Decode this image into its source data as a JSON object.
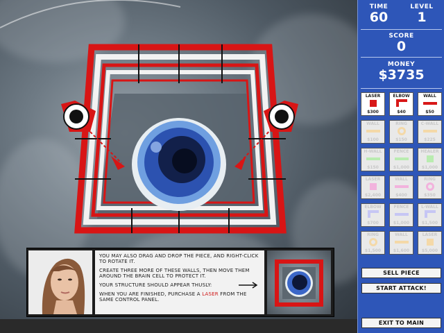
{
  "hud": {
    "time_label": "TIME",
    "time_value": "60",
    "level_label": "LEVEL",
    "level_value": "1",
    "score_label": "SCORE",
    "score_value": "0",
    "money_label": "MONEY",
    "money_value": "$3735"
  },
  "shop": {
    "items": [
      {
        "name": "LASER",
        "price": "$300",
        "icon": "laser-icon",
        "active": true
      },
      {
        "name": "ELBOW",
        "price": "$40",
        "icon": "elbow-icon",
        "active": true
      },
      {
        "name": "WALL",
        "price": "$50",
        "icon": "wall-icon",
        "active": true
      },
      {
        "name": "WALL",
        "price": "$100",
        "icon": "wall-icon",
        "active": false
      },
      {
        "name": "RING",
        "price": "$150",
        "icon": "ring-icon",
        "active": false
      },
      {
        "name": "C-WALL",
        "price": "$225",
        "icon": "c-wall-icon",
        "active": false
      },
      {
        "name": "H-WALL",
        "price": "$150",
        "icon": "h-wall-icon",
        "active": false
      },
      {
        "name": "FENCE",
        "price": "$1,000",
        "icon": "fence-icon",
        "active": false
      },
      {
        "name": "HEALER",
        "price": "$1,000",
        "icon": "healer-icon",
        "active": false
      },
      {
        "name": "LASER",
        "price": "$2,400",
        "icon": "laser-icon",
        "active": false
      },
      {
        "name": "WALL",
        "price": "$400",
        "icon": "wall-icon",
        "active": false
      },
      {
        "name": "RING",
        "price": "$350",
        "icon": "ring-icon",
        "active": false
      },
      {
        "name": "ELBOW",
        "price": "$700",
        "icon": "elbow-icon",
        "active": false
      },
      {
        "name": "FENCE",
        "price": "$1,000",
        "icon": "fence-icon",
        "active": false
      },
      {
        "name": "L-WALL",
        "price": "$1,500",
        "icon": "l-wall-icon",
        "active": false
      },
      {
        "name": "RING",
        "price": "$1,500",
        "icon": "ring-icon",
        "active": false
      },
      {
        "name": "WALL",
        "price": "$1,600",
        "icon": "wall-icon",
        "active": false
      },
      {
        "name": "LASER",
        "price": "$5,000",
        "icon": "laser-icon",
        "active": false
      }
    ],
    "colors": {
      "active": "#d81818",
      "dim": "#f4d9a8",
      "dim_pink": "#f2b3dd",
      "dim_green": "#b9ecb0",
      "dim_purple": "#c6c6f4"
    }
  },
  "buttons": {
    "sell_piece": "SELL PIECE",
    "start_attack": "START ATTACK!",
    "exit_to_main": "EXIT TO MAIN"
  },
  "dialog": {
    "line1": "YOU MAY ALSO DRAG AND DROP THE PIECE, AND RIGHT-CLICK TO ROTATE IT.",
    "line2": "CREATE THREE MORE OF THESE WALLS, THEN MOVE THEM AROUND THE BRAIN CELL TO PROTECT IT.",
    "line3": "YOUR STRUCTURE SHOULD APPEAR THUSLY:",
    "line4_pre": "WHEN YOU ARE FINISHED, PURCHASE A ",
    "line4_hl": "LASER",
    "line4_post": " FROM THE SAME CONTROL PANEL.",
    "arrow": "arrow-right-icon"
  }
}
